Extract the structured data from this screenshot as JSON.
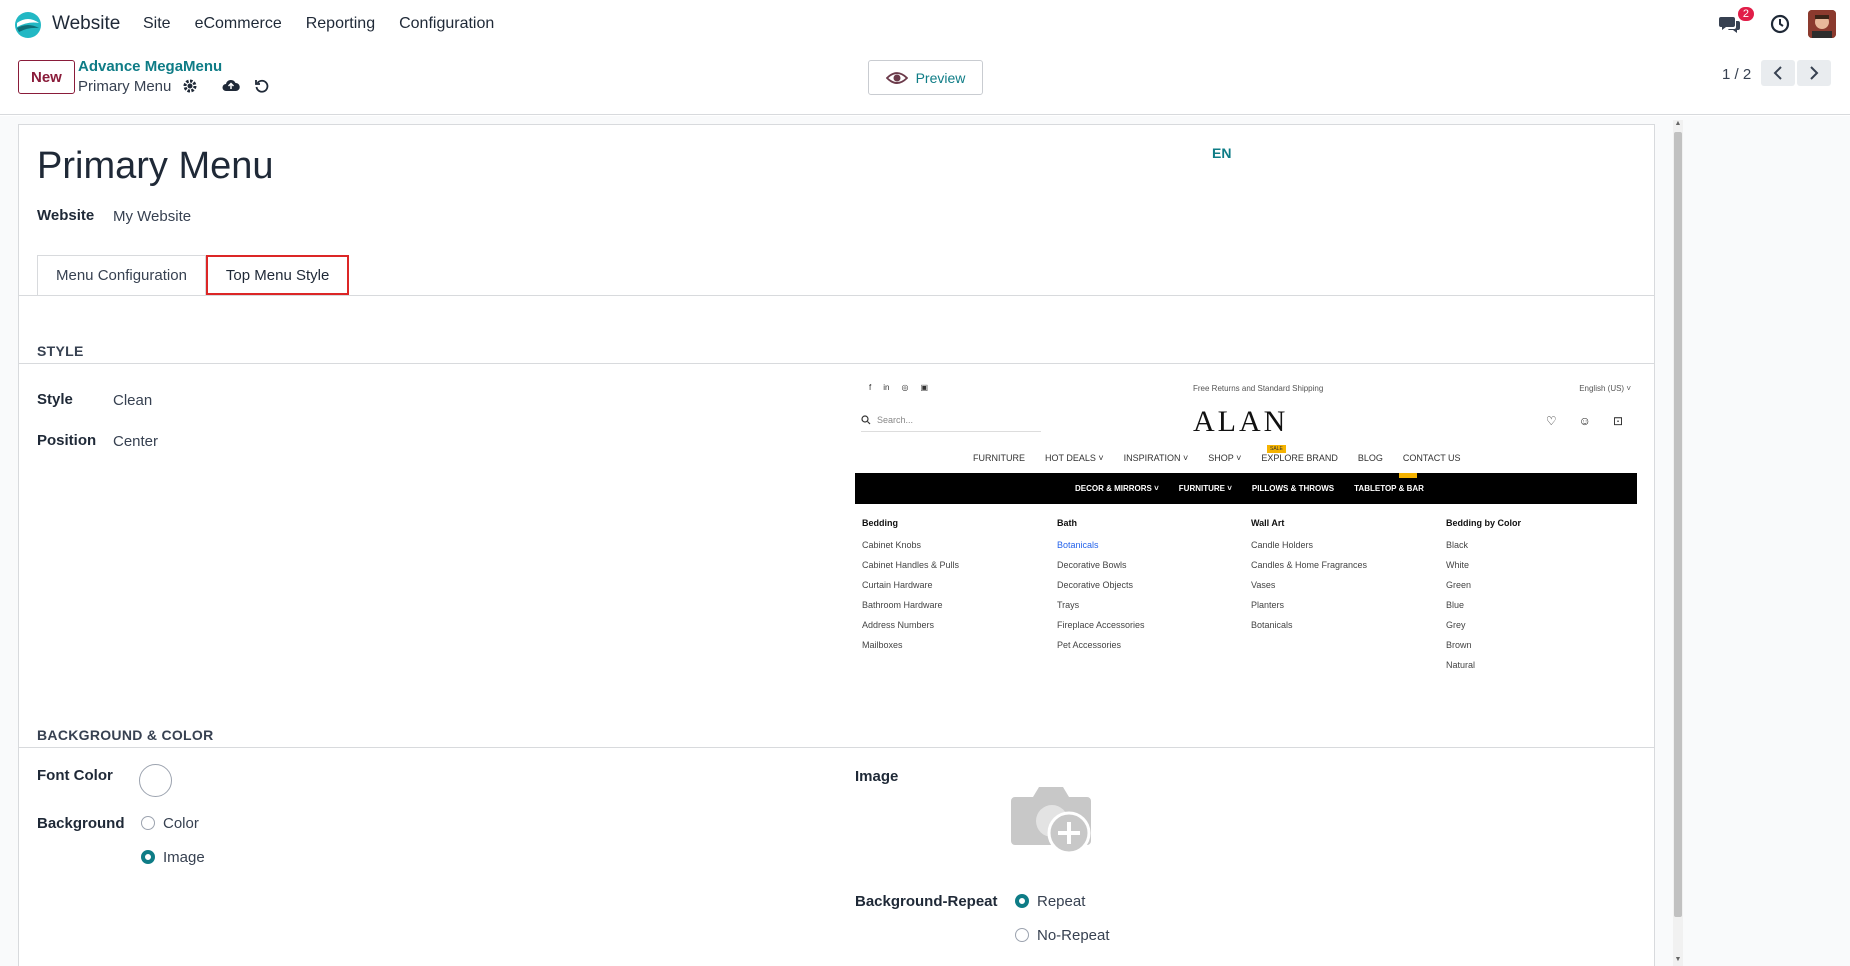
{
  "navbar": {
    "app_name": "Website",
    "menu": [
      "Site",
      "eCommerce",
      "Reporting",
      "Configuration"
    ],
    "message_badge": "2"
  },
  "control_panel": {
    "new_label": "New",
    "breadcrumb_parent": "Advance MegaMenu",
    "breadcrumb_current": "Primary Menu",
    "preview_label": "Preview",
    "pager": "1 / 2"
  },
  "form": {
    "title": "Primary Menu",
    "lang": "EN",
    "website_label": "Website",
    "website_value": "My Website",
    "tabs": [
      "Menu Configuration",
      "Top Menu Style"
    ],
    "style_section": "STYLE",
    "style_label": "Style",
    "style_value": "Clean",
    "position_label": "Position",
    "position_value": "Center",
    "bg_section": "BACKGROUND & COLOR",
    "font_color_label": "Font Color",
    "background_label": "Background",
    "bg_option_color": "Color",
    "bg_option_image": "Image",
    "image_label": "Image",
    "bg_repeat_label": "Background-Repeat",
    "repeat_option": "Repeat",
    "no_repeat_option": "No-Repeat"
  },
  "preview_image": {
    "shipping": "Free Returns and Standard Shipping",
    "language": "English (US)",
    "search_placeholder": "Search...",
    "logo": "ALAN",
    "nav": [
      "FURNITURE",
      "HOT DEALS",
      "INSPIRATION",
      "SHOP",
      "EXPLORE BRAND",
      "BLOG",
      "CONTACT US"
    ],
    "sale_tag": "SALE",
    "bar": [
      "DECOR & MIRRORS",
      "FURNITURE",
      "PILLOWS & THROWS",
      "TABLETOP & BAR"
    ],
    "columns": [
      {
        "title": "Bedding",
        "items": [
          "Cabinet Knobs",
          "Cabinet Handles & Pulls",
          "Curtain Hardware",
          "Bathroom Hardware",
          "Address Numbers",
          "Mailboxes"
        ]
      },
      {
        "title": "Bath",
        "items": [
          "Botanicals",
          "Decorative Bowls",
          "Decorative Objects",
          "Trays",
          "Fireplace Accessories",
          "Pet Accessories"
        ]
      },
      {
        "title": "Wall Art",
        "items": [
          "Candle Holders",
          "Candles & Home Fragrances",
          "Vases",
          "Planters",
          "Botanicals"
        ]
      },
      {
        "title": "Bedding by Color",
        "items": [
          "Black",
          "White",
          "Green",
          "Blue",
          "Grey",
          "Brown",
          "Natural"
        ]
      }
    ]
  },
  "colors": {
    "accent": "#0e7c86",
    "brand": "#8a1c3a",
    "active_tab_border": "#dc2626"
  }
}
